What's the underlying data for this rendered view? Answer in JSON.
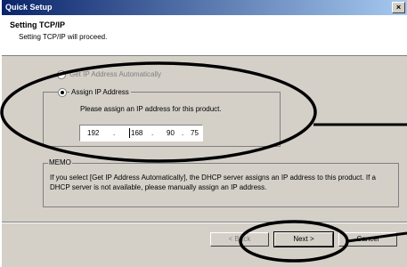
{
  "window": {
    "title": "Quick Setup",
    "close_glyph": "×"
  },
  "header": {
    "title": "Setting TCP/IP",
    "subtitle": "Setting TCP/IP will proceed."
  },
  "options": {
    "auto_label": "Get IP Address Automatically",
    "assign_label": "Assign IP Address",
    "selected": "Assign IP Address"
  },
  "assign": {
    "hint": "Please assign an IP address for this product.",
    "ip": [
      "192",
      "168",
      "90",
      "75"
    ],
    "separator": "."
  },
  "memo": {
    "label": "MEMO",
    "text": "If you select [Get IP Address Automatically], the DHCP server assigns an IP address to this product. If a DHCP server is not available, please manually assign an IP address."
  },
  "buttons": {
    "back": "< Back",
    "next": "Next >",
    "cancel": "Cancel"
  },
  "annotations": {
    "stroke_color": "#000000"
  }
}
